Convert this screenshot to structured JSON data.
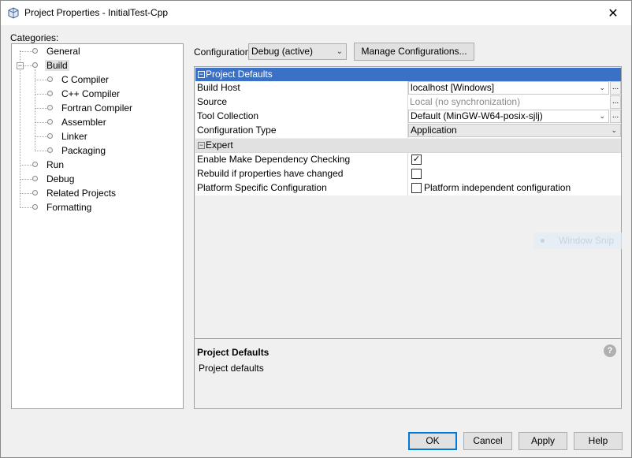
{
  "window": {
    "title": "Project Properties - InitialTest-Cpp"
  },
  "categories": {
    "label": "Categories:",
    "items": [
      {
        "label": "General"
      },
      {
        "label": "Build"
      },
      {
        "label": "C Compiler"
      },
      {
        "label": "C++ Compiler"
      },
      {
        "label": "Fortran Compiler"
      },
      {
        "label": "Assembler"
      },
      {
        "label": "Linker"
      },
      {
        "label": "Packaging"
      },
      {
        "label": "Run"
      },
      {
        "label": "Debug"
      },
      {
        "label": "Related Projects"
      },
      {
        "label": "Formatting"
      }
    ]
  },
  "configuration": {
    "label": "Configuration:",
    "selected": "Debug (active)",
    "manage_label": "Manage Configurations..."
  },
  "properties": {
    "header": "Project Defaults",
    "rows": [
      {
        "name": "Build Host",
        "value": "localhost [Windows]"
      },
      {
        "name": "Source",
        "value": "Local (no synchronization)"
      },
      {
        "name": "Tool Collection",
        "value": "Default (MinGW-W64-posix-sjlj)"
      },
      {
        "name": "Configuration Type",
        "value": "Application"
      }
    ],
    "expert_label": "Expert",
    "expert_rows": [
      {
        "name": "Enable Make Dependency Checking",
        "checked": true
      },
      {
        "name": "Rebuild if properties have changed",
        "checked": false
      },
      {
        "name": "Platform Specific Configuration",
        "checked": false,
        "value": "Platform independent configuration"
      }
    ]
  },
  "help": {
    "title": "Project Defaults",
    "description": "Project defaults"
  },
  "overlay": {
    "snip_label": "Window Snip"
  },
  "buttons": {
    "ok": "OK",
    "cancel": "Cancel",
    "apply": "Apply",
    "help": "Help"
  }
}
